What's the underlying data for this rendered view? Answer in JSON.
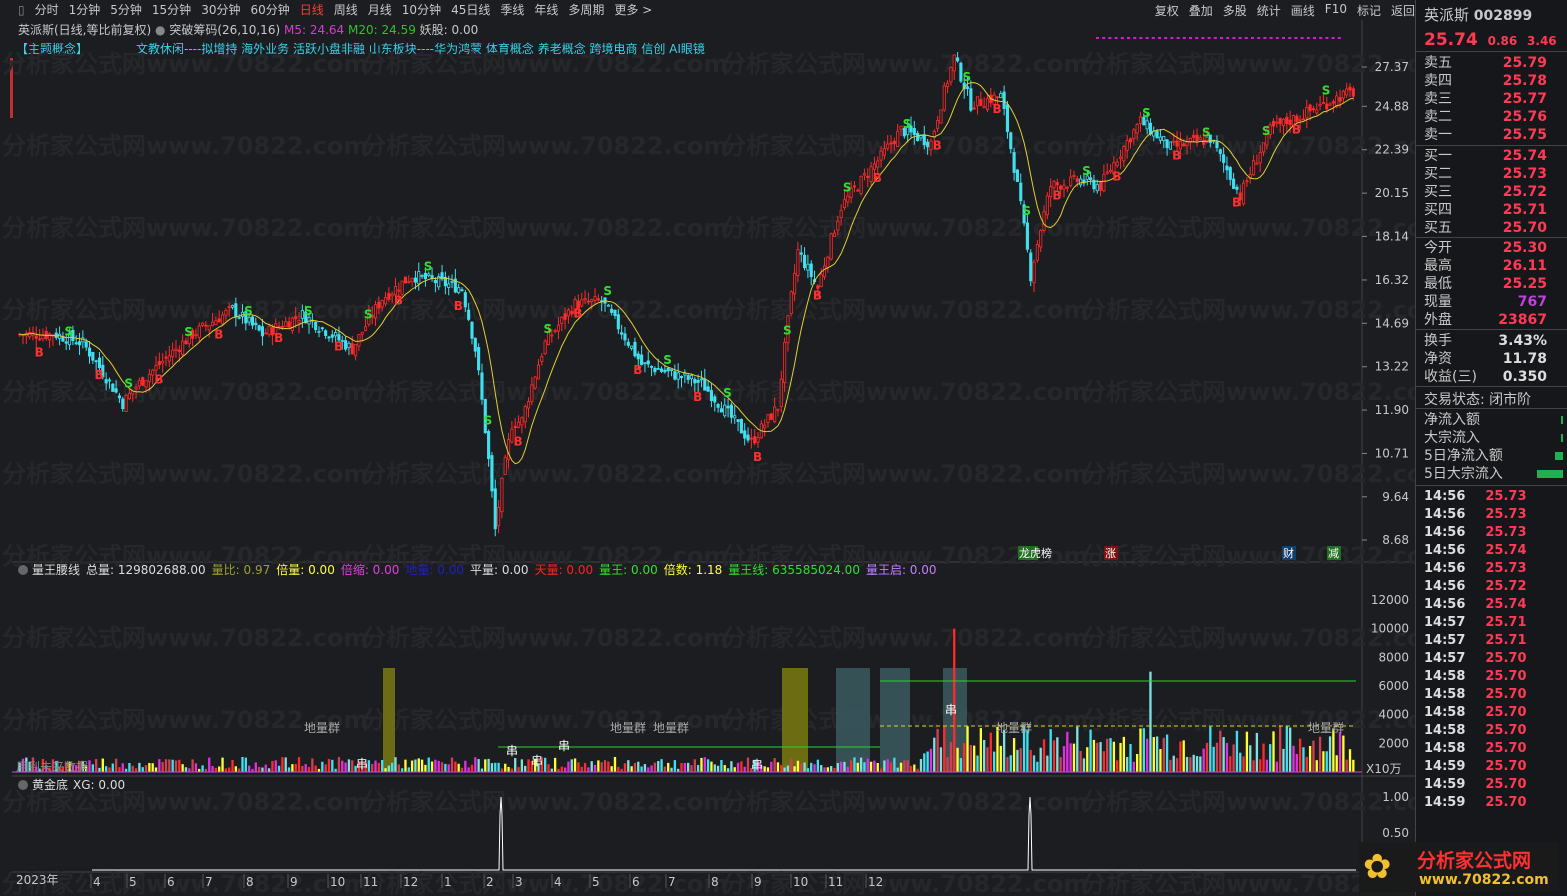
{
  "periods": [
    "分时",
    "1分钟",
    "5分钟",
    "15分钟",
    "30分钟",
    "60分钟",
    "日线",
    "周线",
    "月线",
    "10分钟",
    "45日线",
    "季线",
    "年线",
    "多周期",
    "更多 >"
  ],
  "active_period": "日线",
  "tools": [
    "复权",
    "叠加",
    "多股",
    "统计",
    "画线",
    "F10",
    "标记",
    "返回"
  ],
  "info": {
    "name": "英派斯(日线,等比前复权)",
    "indicator": "突破筹码(26,10,16)",
    "m5": "M5: 24.64",
    "m20": "M20: 24.59",
    "yao": "妖股: 0.00"
  },
  "concept": {
    "tag": "【主题概念】",
    "text": "文教休闲----拟增持 海外业务 活跃小盘非融 山东板块----华为鸿蒙 体育概念 养老概念 跨境电商 信创 AI眼镜"
  },
  "price_axis": [
    "27.37",
    "24.88",
    "22.39",
    "20.15",
    "18.14",
    "16.32",
    "14.69",
    "13.22",
    "11.90",
    "10.71",
    "9.64",
    "8.68"
  ],
  "vol_indicator": [
    {
      "t": "量王腰线",
      "c": "#dddddd"
    },
    {
      "t": "总量: 129802688.00",
      "c": "#dddddd"
    },
    {
      "t": "量比: 0.97",
      "c": "#a0a030"
    },
    {
      "t": "倍量: 0.00",
      "c": "#ffff40"
    },
    {
      "t": "倍缩: 0.00",
      "c": "#e040e0"
    },
    {
      "t": "地量: 0.00",
      "c": "#2020c0"
    },
    {
      "t": "平量: 0.00",
      "c": "#dddddd"
    },
    {
      "t": "天量: 0.00",
      "c": "#ff2020"
    },
    {
      "t": "量王: 0.00",
      "c": "#30e030"
    },
    {
      "t": "倍数: 1.18",
      "c": "#ffff40"
    },
    {
      "t": "量王线: 635585024.00",
      "c": "#30e030"
    },
    {
      "t": "量王启: 0.00",
      "c": "#c080ff"
    }
  ],
  "vol_axis": [
    "12000",
    "10000",
    "8000",
    "6000",
    "4000",
    "2000"
  ],
  "vol_unit": "X10万",
  "vol_labels": [
    "地量群",
    "地量群",
    "地量群",
    "地量群",
    "地量群",
    "串",
    "串",
    "串",
    "串",
    "串",
    "串",
    "用到未来数据"
  ],
  "markers": [
    "龙虎榜",
    "涨",
    "财",
    "减"
  ],
  "gold": {
    "title": "黄金底",
    "xg": "XG: 0.00",
    "axis": [
      "1.00",
      "0.50"
    ]
  },
  "date_axis": {
    "year": "2023年",
    "months": [
      "4",
      "5",
      "6",
      "7",
      "8",
      "9",
      "10",
      "11",
      "12",
      "1",
      "2",
      "3",
      "4",
      "5",
      "6",
      "7",
      "8",
      "9",
      "10",
      "11",
      "12"
    ]
  },
  "chart_data": {
    "type": "candlestick",
    "price_path": [
      [
        0,
        14.3
      ],
      [
        11,
        14.3
      ],
      [
        19,
        14.0
      ],
      [
        31,
        12.1
      ],
      [
        35,
        12.6
      ],
      [
        52,
        14.3
      ],
      [
        64,
        15.2
      ],
      [
        73,
        14.3
      ],
      [
        85,
        15.0
      ],
      [
        100,
        13.8
      ],
      [
        109,
        15.6
      ],
      [
        118,
        16.5
      ],
      [
        127,
        16.2
      ],
      [
        133,
        16.0
      ],
      [
        137,
        13.8
      ],
      [
        143,
        8.9
      ],
      [
        148,
        11.5
      ],
      [
        151,
        11.6
      ],
      [
        158,
        14.0
      ],
      [
        167,
        15.4
      ],
      [
        175,
        15.5
      ],
      [
        187,
        13.3
      ],
      [
        205,
        12.7
      ],
      [
        220,
        11.0
      ],
      [
        228,
        12.0
      ],
      [
        234,
        17.5
      ],
      [
        240,
        16.0
      ],
      [
        247,
        19.5
      ],
      [
        259,
        22.0
      ],
      [
        265,
        23.5
      ],
      [
        274,
        22.8
      ],
      [
        281,
        28.0
      ],
      [
        286,
        25.0
      ],
      [
        295,
        25.5
      ],
      [
        304,
        16.5
      ],
      [
        310,
        20.5
      ],
      [
        319,
        20.8
      ],
      [
        325,
        20.5
      ],
      [
        337,
        24.0
      ],
      [
        346,
        22.5
      ],
      [
        358,
        23.0
      ],
      [
        367,
        20.0
      ],
      [
        376,
        23.5
      ],
      [
        385,
        24.3
      ],
      [
        397,
        25.5
      ],
      [
        401,
        25.74
      ]
    ],
    "ma_color": "#e0d030"
  },
  "side": {
    "name": "英派斯",
    "code": "002899",
    "price": "25.74",
    "chg": "0.86",
    "pct": "3.46",
    "asks": [
      [
        "卖五",
        "25.79"
      ],
      [
        "卖四",
        "25.78"
      ],
      [
        "卖三",
        "25.77"
      ],
      [
        "卖二",
        "25.76"
      ],
      [
        "卖一",
        "25.75"
      ]
    ],
    "bids": [
      [
        "买一",
        "25.74"
      ],
      [
        "买二",
        "25.73"
      ],
      [
        "买三",
        "25.72"
      ],
      [
        "买四",
        "25.71"
      ],
      [
        "买五",
        "25.70"
      ]
    ],
    "stats": [
      [
        "今开",
        "25.30",
        "#ff3a55"
      ],
      [
        "最高",
        "26.11",
        "#ff3a55"
      ],
      [
        "最低",
        "25.25",
        "#ff3a55"
      ],
      [
        "现量",
        "767",
        "#c040e0"
      ],
      [
        "外盘",
        "23867",
        "#ff3a55"
      ]
    ],
    "stats2": [
      [
        "换手",
        "3.43%"
      ],
      [
        "净资",
        "11.78"
      ],
      [
        "收益(三)",
        "0.350"
      ]
    ],
    "status": "交易状态: 闭市阶",
    "flows": [
      [
        "净流入额",
        0.04
      ],
      [
        "大宗流入",
        0.02
      ],
      [
        "5日净流入额",
        0.3
      ],
      [
        "5日大宗流入",
        1.0
      ]
    ],
    "ticks": [
      [
        "14:56",
        "25.73"
      ],
      [
        "14:56",
        "25.73"
      ],
      [
        "14:56",
        "25.73"
      ],
      [
        "14:56",
        "25.74"
      ],
      [
        "14:56",
        "25.73"
      ],
      [
        "14:56",
        "25.72"
      ],
      [
        "14:56",
        "25.74"
      ],
      [
        "14:57",
        "25.71"
      ],
      [
        "14:57",
        "25.71"
      ],
      [
        "14:57",
        "25.70"
      ],
      [
        "14:58",
        "25.70"
      ],
      [
        "14:58",
        "25.70"
      ],
      [
        "14:58",
        "25.70"
      ],
      [
        "14:58",
        "25.70"
      ],
      [
        "14:58",
        "25.70"
      ],
      [
        "14:59",
        "25.70"
      ],
      [
        "14:59",
        "25.70"
      ],
      [
        "14:59",
        "25.70"
      ]
    ],
    "logo": "分析家公式网",
    "logo_url": "www.70822.com"
  }
}
